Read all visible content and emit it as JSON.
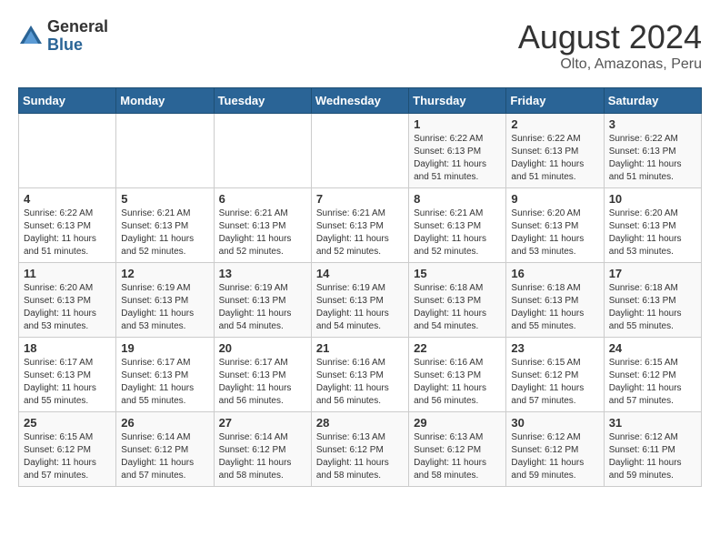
{
  "logo": {
    "general": "General",
    "blue": "Blue"
  },
  "title": {
    "month_year": "August 2024",
    "location": "Olto, Amazonas, Peru"
  },
  "headers": [
    "Sunday",
    "Monday",
    "Tuesday",
    "Wednesday",
    "Thursday",
    "Friday",
    "Saturday"
  ],
  "weeks": [
    [
      {
        "day": "",
        "info": ""
      },
      {
        "day": "",
        "info": ""
      },
      {
        "day": "",
        "info": ""
      },
      {
        "day": "",
        "info": ""
      },
      {
        "day": "1",
        "info": "Sunrise: 6:22 AM\nSunset: 6:13 PM\nDaylight: 11 hours\nand 51 minutes."
      },
      {
        "day": "2",
        "info": "Sunrise: 6:22 AM\nSunset: 6:13 PM\nDaylight: 11 hours\nand 51 minutes."
      },
      {
        "day": "3",
        "info": "Sunrise: 6:22 AM\nSunset: 6:13 PM\nDaylight: 11 hours\nand 51 minutes."
      }
    ],
    [
      {
        "day": "4",
        "info": "Sunrise: 6:22 AM\nSunset: 6:13 PM\nDaylight: 11 hours\nand 51 minutes."
      },
      {
        "day": "5",
        "info": "Sunrise: 6:21 AM\nSunset: 6:13 PM\nDaylight: 11 hours\nand 52 minutes."
      },
      {
        "day": "6",
        "info": "Sunrise: 6:21 AM\nSunset: 6:13 PM\nDaylight: 11 hours\nand 52 minutes."
      },
      {
        "day": "7",
        "info": "Sunrise: 6:21 AM\nSunset: 6:13 PM\nDaylight: 11 hours\nand 52 minutes."
      },
      {
        "day": "8",
        "info": "Sunrise: 6:21 AM\nSunset: 6:13 PM\nDaylight: 11 hours\nand 52 minutes."
      },
      {
        "day": "9",
        "info": "Sunrise: 6:20 AM\nSunset: 6:13 PM\nDaylight: 11 hours\nand 53 minutes."
      },
      {
        "day": "10",
        "info": "Sunrise: 6:20 AM\nSunset: 6:13 PM\nDaylight: 11 hours\nand 53 minutes."
      }
    ],
    [
      {
        "day": "11",
        "info": "Sunrise: 6:20 AM\nSunset: 6:13 PM\nDaylight: 11 hours\nand 53 minutes."
      },
      {
        "day": "12",
        "info": "Sunrise: 6:19 AM\nSunset: 6:13 PM\nDaylight: 11 hours\nand 53 minutes."
      },
      {
        "day": "13",
        "info": "Sunrise: 6:19 AM\nSunset: 6:13 PM\nDaylight: 11 hours\nand 54 minutes."
      },
      {
        "day": "14",
        "info": "Sunrise: 6:19 AM\nSunset: 6:13 PM\nDaylight: 11 hours\nand 54 minutes."
      },
      {
        "day": "15",
        "info": "Sunrise: 6:18 AM\nSunset: 6:13 PM\nDaylight: 11 hours\nand 54 minutes."
      },
      {
        "day": "16",
        "info": "Sunrise: 6:18 AM\nSunset: 6:13 PM\nDaylight: 11 hours\nand 55 minutes."
      },
      {
        "day": "17",
        "info": "Sunrise: 6:18 AM\nSunset: 6:13 PM\nDaylight: 11 hours\nand 55 minutes."
      }
    ],
    [
      {
        "day": "18",
        "info": "Sunrise: 6:17 AM\nSunset: 6:13 PM\nDaylight: 11 hours\nand 55 minutes."
      },
      {
        "day": "19",
        "info": "Sunrise: 6:17 AM\nSunset: 6:13 PM\nDaylight: 11 hours\nand 55 minutes."
      },
      {
        "day": "20",
        "info": "Sunrise: 6:17 AM\nSunset: 6:13 PM\nDaylight: 11 hours\nand 56 minutes."
      },
      {
        "day": "21",
        "info": "Sunrise: 6:16 AM\nSunset: 6:13 PM\nDaylight: 11 hours\nand 56 minutes."
      },
      {
        "day": "22",
        "info": "Sunrise: 6:16 AM\nSunset: 6:13 PM\nDaylight: 11 hours\nand 56 minutes."
      },
      {
        "day": "23",
        "info": "Sunrise: 6:15 AM\nSunset: 6:12 PM\nDaylight: 11 hours\nand 57 minutes."
      },
      {
        "day": "24",
        "info": "Sunrise: 6:15 AM\nSunset: 6:12 PM\nDaylight: 11 hours\nand 57 minutes."
      }
    ],
    [
      {
        "day": "25",
        "info": "Sunrise: 6:15 AM\nSunset: 6:12 PM\nDaylight: 11 hours\nand 57 minutes."
      },
      {
        "day": "26",
        "info": "Sunrise: 6:14 AM\nSunset: 6:12 PM\nDaylight: 11 hours\nand 57 minutes."
      },
      {
        "day": "27",
        "info": "Sunrise: 6:14 AM\nSunset: 6:12 PM\nDaylight: 11 hours\nand 58 minutes."
      },
      {
        "day": "28",
        "info": "Sunrise: 6:13 AM\nSunset: 6:12 PM\nDaylight: 11 hours\nand 58 minutes."
      },
      {
        "day": "29",
        "info": "Sunrise: 6:13 AM\nSunset: 6:12 PM\nDaylight: 11 hours\nand 58 minutes."
      },
      {
        "day": "30",
        "info": "Sunrise: 6:12 AM\nSunset: 6:12 PM\nDaylight: 11 hours\nand 59 minutes."
      },
      {
        "day": "31",
        "info": "Sunrise: 6:12 AM\nSunset: 6:11 PM\nDaylight: 11 hours\nand 59 minutes."
      }
    ]
  ]
}
